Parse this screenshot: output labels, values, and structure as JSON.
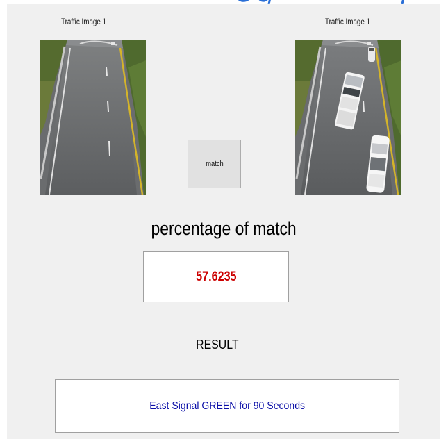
{
  "images": [
    {
      "label": "Traffic Image 1",
      "icon": "empty-road-image"
    },
    {
      "label": "Traffic Image 1",
      "icon": "road-with-cars-image"
    }
  ],
  "match_button": {
    "label": "match"
  },
  "percentage": {
    "title": "percentage of match",
    "value": "57.6235",
    "value_color": "#cc0000"
  },
  "result": {
    "label": "RESULT",
    "text": "East Signal GREEN for 90 Seconds",
    "text_color": "#0b0fa8"
  }
}
